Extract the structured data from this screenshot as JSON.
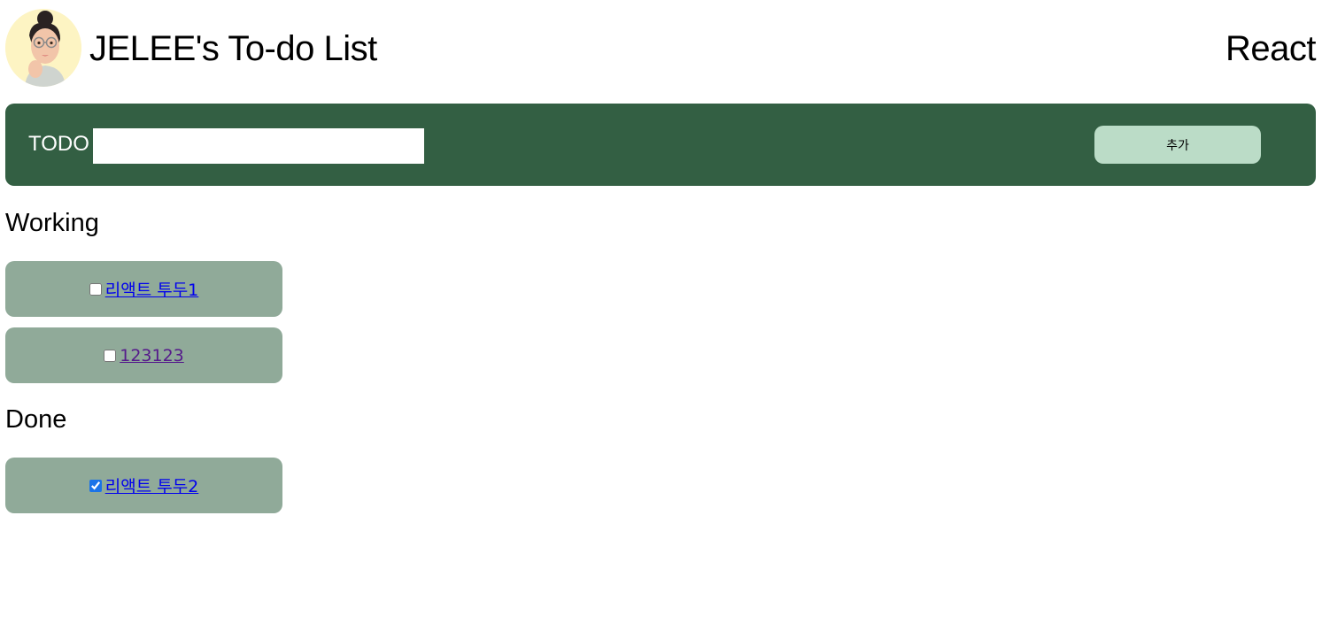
{
  "header": {
    "title": "JELEE's To-do List",
    "brand": "React"
  },
  "form": {
    "label": "TODO",
    "input_value": "",
    "input_placeholder": "",
    "add_label": "추가",
    "colors": {
      "panel": "#335f43",
      "button": "#bbdcc7"
    }
  },
  "working": {
    "title": "Working",
    "items": [
      {
        "label": "리액트 투두1",
        "checked": false
      },
      {
        "label": "123123",
        "checked": false
      }
    ]
  },
  "done": {
    "title": "Done",
    "items": [
      {
        "label": "리액트 투두2",
        "checked": true
      }
    ]
  },
  "colors": {
    "card": "#90aa99",
    "avatar_bg": "#fdf4c3"
  }
}
